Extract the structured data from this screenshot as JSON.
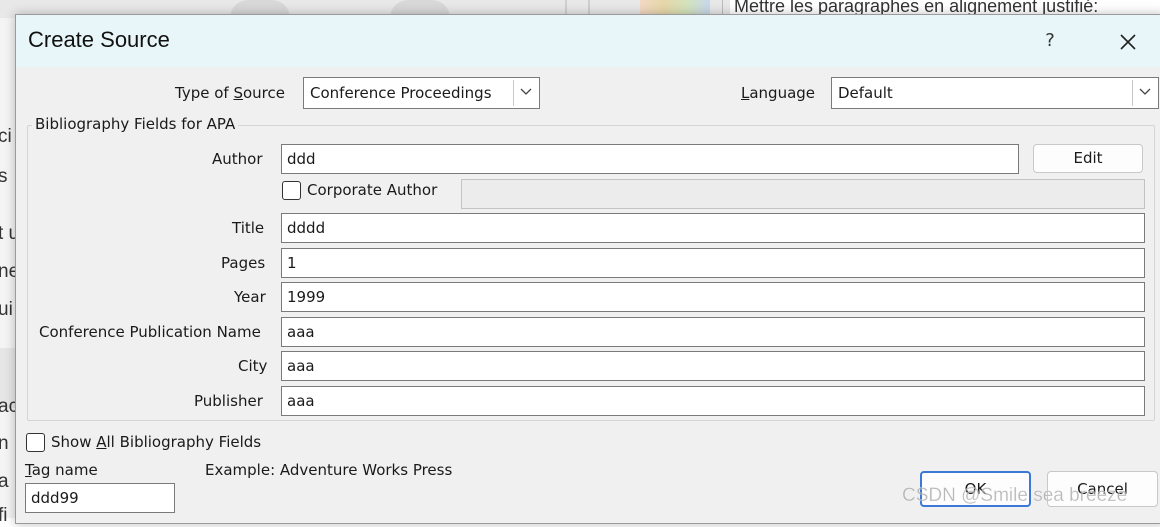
{
  "background": {
    "heading": "Mettre les paragraphes en alignement justifié:",
    "left_fragments": [
      "ci",
      "s",
      "t u",
      "ne",
      "ui",
      "ac",
      "n",
      "a",
      "fi"
    ]
  },
  "dialog": {
    "title": "Create Source",
    "help_label": "?",
    "type_of_source": {
      "label_pre": "Type of ",
      "label_accel": "S",
      "label_post": "ource",
      "value": "Conference Proceedings"
    },
    "language": {
      "label_accel": "L",
      "label_post": "anguage",
      "value": "Default"
    },
    "group_title": "Bibliography Fields for APA",
    "fields": {
      "author": {
        "label": "Author",
        "value": "ddd"
      },
      "edit_button": "Edit",
      "corporate_author": {
        "label": "Corporate Author",
        "checked": false,
        "value": ""
      },
      "title": {
        "label": "Title",
        "value": "dddd"
      },
      "pages": {
        "label": "Pages",
        "value": "1"
      },
      "year": {
        "label": "Year",
        "value": "1999"
      },
      "conference_publication_name": {
        "label": "Conference Publication Name",
        "value": "aaa"
      },
      "city": {
        "label": "City",
        "value": "aaa"
      },
      "publisher": {
        "label": "Publisher",
        "value": "aaa"
      }
    },
    "show_all": {
      "label_pre": "Show ",
      "label_accel": "A",
      "label_post": "ll Bibliography Fields",
      "checked": false
    },
    "tag_name": {
      "label_accel": "T",
      "label_post": "ag name",
      "value": "ddd99"
    },
    "example_text": "Example: Adventure Works Press",
    "ok_button": "OK",
    "cancel_button": "Cancel"
  },
  "watermark": "CSDN @Smile sea breeze",
  "colors": {
    "titlebar": "#e9f6f9",
    "dialog_bg": "#f0f0f0",
    "focus_border": "#3b78d8"
  }
}
